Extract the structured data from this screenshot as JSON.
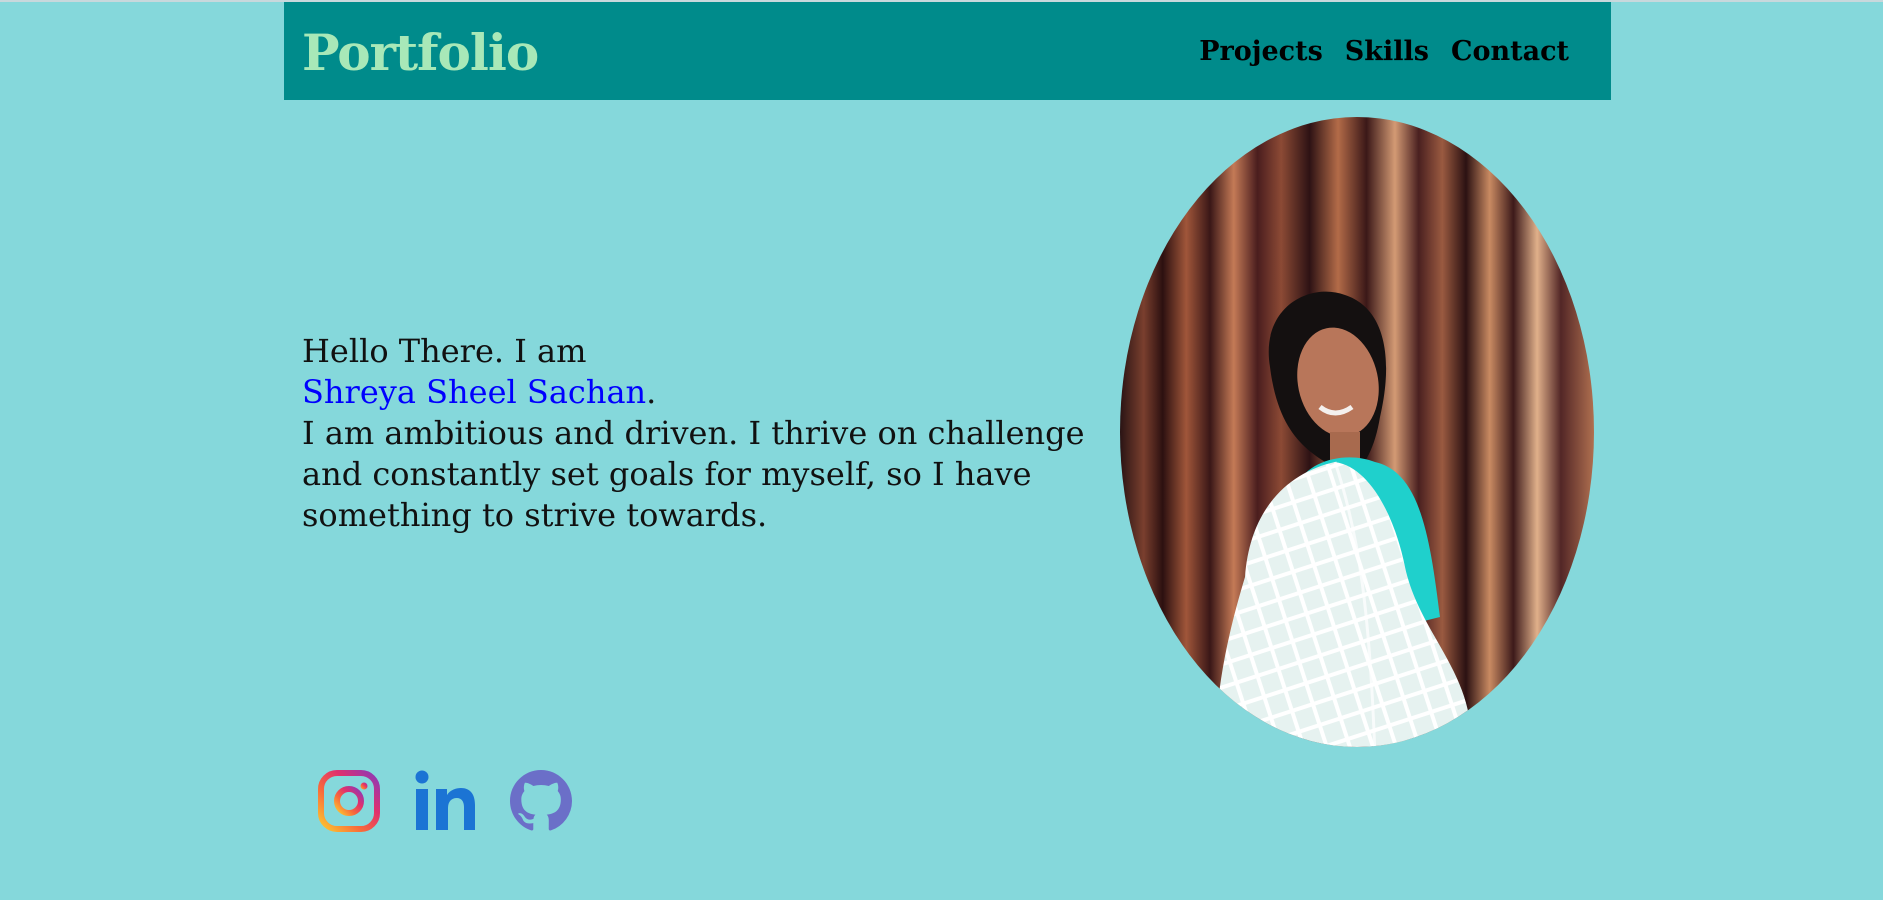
{
  "brand": "Portfolio",
  "nav": [
    "Projects",
    "Skills",
    "Contact"
  ],
  "intro": {
    "greeting": "Hello There. I am",
    "name": "Shreya Sheel Sachan",
    "period": ".",
    "line1": "I am ambitious and driven. I thrive on challenge",
    "line2": "and constantly set goals for myself, so I have",
    "line3": "something to strive towards."
  },
  "socials": [
    "instagram-icon",
    "linkedin-icon",
    "github-icon"
  ],
  "colors": {
    "page_bg": "#85d8db",
    "navbar_bg": "#008b8b",
    "brand_text": "#a8e8b8",
    "name_link": "#0000ff",
    "linkedin": "#1b74d4",
    "github": "#6b6fc8"
  }
}
